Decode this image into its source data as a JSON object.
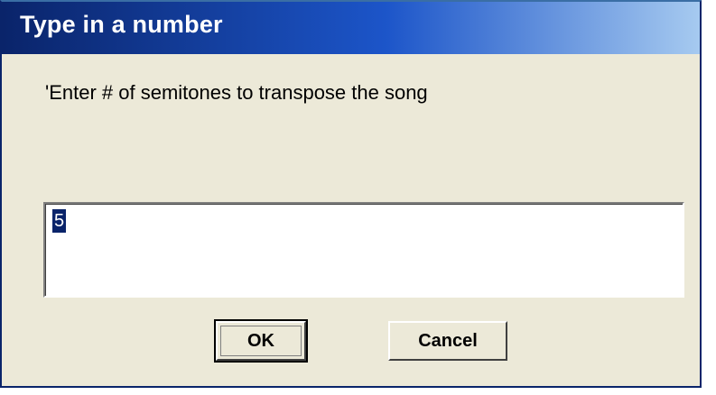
{
  "window": {
    "title": "Type in a number"
  },
  "dialog": {
    "prompt": "'Enter # of semitones to transpose the song",
    "input_value": "5",
    "ok_label": "OK",
    "cancel_label": "Cancel"
  },
  "colors": {
    "titlebar_start": "#0a246a",
    "titlebar_end": "#a6caf0",
    "dialog_background": "#ece9d8",
    "selection_highlight": "#0a246a"
  }
}
